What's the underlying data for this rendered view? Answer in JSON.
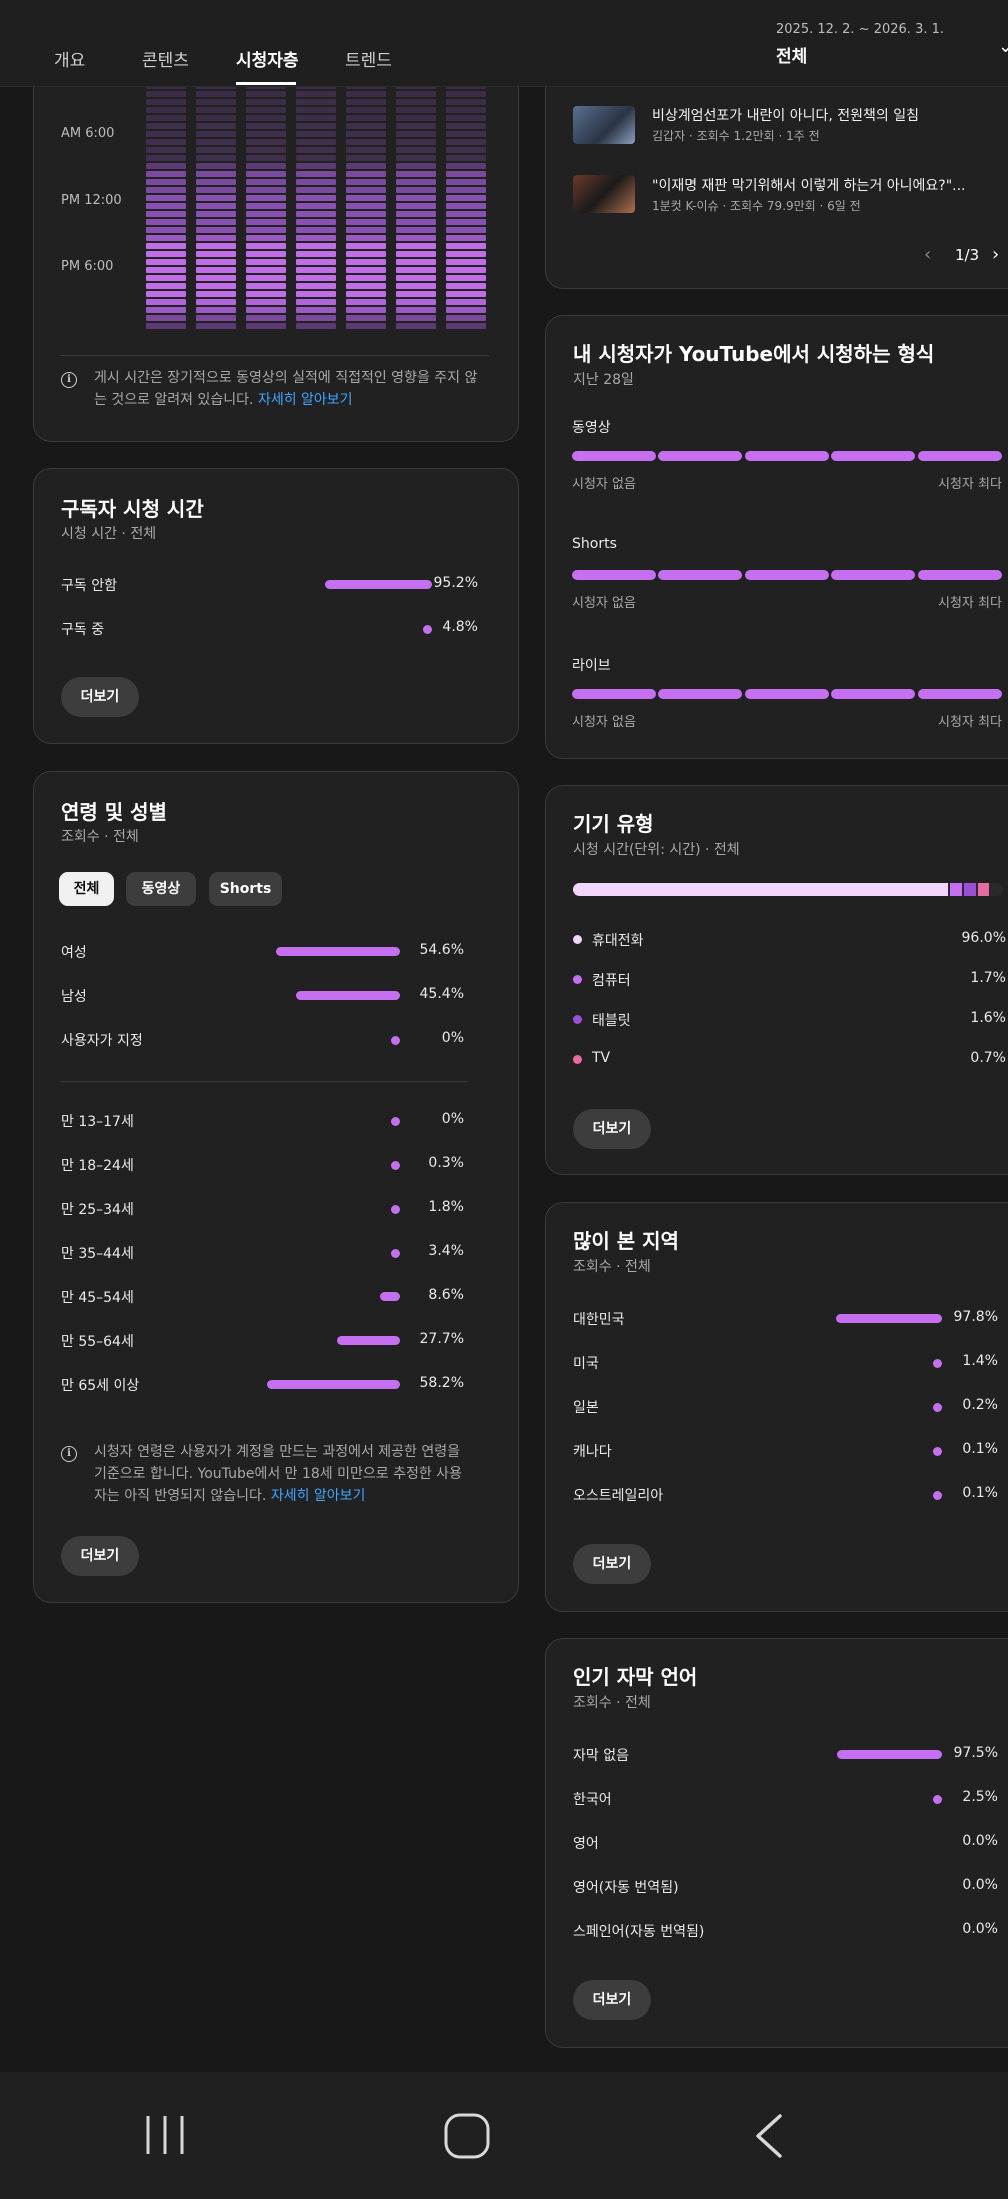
{
  "header": {
    "tabs": [
      "개요",
      "콘텐츠",
      "시청자층",
      "트렌드"
    ],
    "active_tab": "시청자층",
    "date_range": "2025. 12. 2. ~ 2026. 3. 1.",
    "period": "전체"
  },
  "watch_time_heatmap": {
    "time_labels": [
      "AM 6:00",
      "PM 12:00",
      "PM 6:00"
    ],
    "note": "게시 시간은 장기적으로 동영상의 실적에 직접적인 영향을 주지 않는 것으로 알려져 있습니다.",
    "note_line1": "게시 시간은 장기적으로 동영상의 실적에 직접적인 영향을 주지 않",
    "note_line2": "는 것으로 알려져 있습니다.",
    "link": "자세히 알아보기"
  },
  "subscriber_watch_time": {
    "title": "구독자 시청 시간",
    "subtitle": "시청 시간 · 전체",
    "rows": [
      {
        "label": "구독 안함",
        "value": "95.2%",
        "pct": 95.2
      },
      {
        "label": "구독 중",
        "value": "4.8%",
        "pct": 4.8
      }
    ],
    "more": "더보기"
  },
  "age_gender": {
    "title": "연령 및 성별",
    "subtitle": "조회수 · 전체",
    "filters": [
      "전체",
      "동영상",
      "Shorts"
    ],
    "gender_rows": [
      {
        "label": "여성",
        "value": "54.6%",
        "pct": 54.6
      },
      {
        "label": "남성",
        "value": "45.4%",
        "pct": 45.4
      },
      {
        "label": "사용자가 지정",
        "value": "0%",
        "pct": 0
      }
    ],
    "age_rows": [
      {
        "label": "만 13–17세",
        "value": "0%",
        "pct": 0
      },
      {
        "label": "만 18–24세",
        "value": "0.3%",
        "pct": 0.3
      },
      {
        "label": "만 25–34세",
        "value": "1.8%",
        "pct": 1.8
      },
      {
        "label": "만 35–44세",
        "value": "3.4%",
        "pct": 3.4
      },
      {
        "label": "만 45–54세",
        "value": "8.6%",
        "pct": 8.6
      },
      {
        "label": "만 55–64세",
        "value": "27.7%",
        "pct": 27.7
      },
      {
        "label": "만 65세 이상",
        "value": "58.2%",
        "pct": 58.2
      }
    ],
    "note_line1": "시청자 연령은 사용자가 계정을 만드는 과정에서 제공한 연령을",
    "note_line2": "기준으로 합니다. YouTube에서 만 18세 미만으로 추정한 사용",
    "note_line3": "자는 아직 반영되지 않습니다.",
    "link": "자세히 알아보기",
    "more": "더보기"
  },
  "videos": {
    "items": [
      {
        "title": "비상계엄선포가 내란이 아니다, 전원책의 일침",
        "meta": "김갑자 · 조회수 1.2만회 · 1주 전"
      },
      {
        "title": "\"이재명 재판 막기위해서 이렇게 하는거 아니에요?\"...",
        "meta": "1분컷 K-이슈 · 조회수 79.9만회 · 6일 전"
      }
    ],
    "pager": "1/3"
  },
  "formats": {
    "title": "내 시청자가 YouTube에서 시청하는 형식",
    "subtitle": "지난 28일",
    "rows": [
      {
        "label": "동영상",
        "min": "시청자 없음",
        "max": "시청자 최다"
      },
      {
        "label": "Shorts",
        "min": "시청자 없음",
        "max": "시청자 최다"
      },
      {
        "label": "라이브",
        "min": "시청자 없음",
        "max": "시청자 최다"
      }
    ]
  },
  "device": {
    "title": "기기 유형",
    "subtitle": "시청 시간(단위: 시간) · 전체",
    "rows": [
      {
        "label": "휴대전화",
        "value": "96.0%",
        "pct": 96.0,
        "color": "#f2d6fb"
      },
      {
        "label": "컴퓨터",
        "value": "1.7%",
        "pct": 1.7,
        "color": "#c66ff0"
      },
      {
        "label": "태블릿",
        "value": "1.6%",
        "pct": 1.6,
        "color": "#9b4fd6"
      },
      {
        "label": "TV",
        "value": "0.7%",
        "pct": 0.7,
        "color": "#e86aa0"
      }
    ],
    "more": "더보기"
  },
  "geography": {
    "title": "많이 본 지역",
    "subtitle": "조회수 · 전체",
    "rows": [
      {
        "label": "대한민국",
        "value": "97.8%",
        "pct": 97.8
      },
      {
        "label": "미국",
        "value": "1.4%",
        "pct": 1.4
      },
      {
        "label": "일본",
        "value": "0.2%",
        "pct": 0.2
      },
      {
        "label": "캐나다",
        "value": "0.1%",
        "pct": 0.1
      },
      {
        "label": "오스트레일리아",
        "value": "0.1%",
        "pct": 0.1
      }
    ],
    "more": "더보기"
  },
  "subtitles": {
    "title": "인기 자막 언어",
    "subtitle": "조회수 · 전체",
    "rows": [
      {
        "label": "자막 없음",
        "value": "97.5%",
        "pct": 97.5
      },
      {
        "label": "한국어",
        "value": "2.5%",
        "pct": 2.5
      },
      {
        "label": "영어",
        "value": "0.0%",
        "pct": 0
      },
      {
        "label": "영어(자동 번역됨)",
        "value": "0.0%",
        "pct": 0
      },
      {
        "label": "스페인어(자동 번역됨)",
        "value": "0.0%",
        "pct": 0
      }
    ],
    "more": "더보기"
  },
  "colors": {
    "accent": "#c66ff0",
    "link": "#3ea6ff",
    "background": "#181818",
    "card": "#212121"
  }
}
